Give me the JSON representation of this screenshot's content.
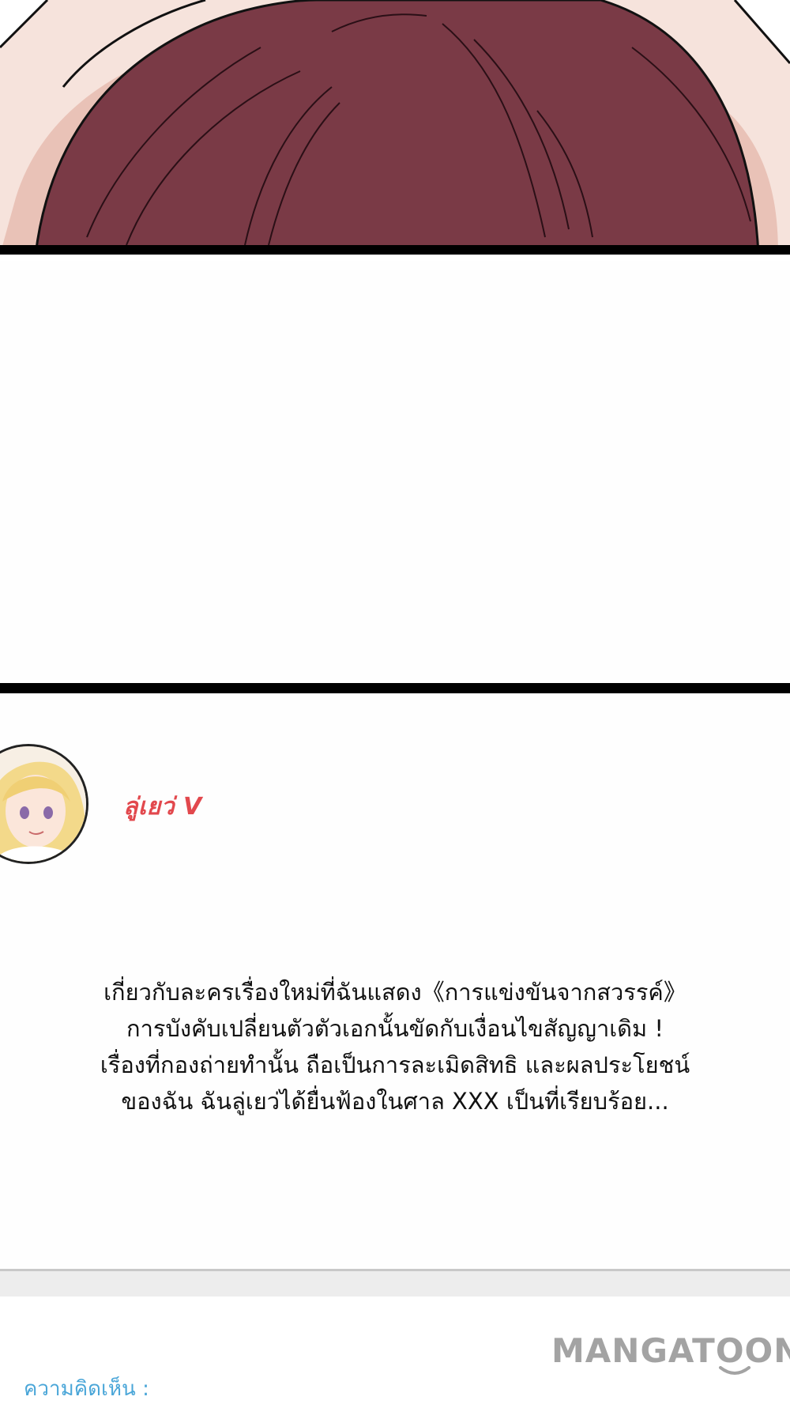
{
  "post": {
    "author_name": "ลู่เยว่ V",
    "body_lines": [
      "เกี่ยวกับละครเรื่องใหม่ที่ฉันแสดง《การแข่งขันจากสวรรค์》",
      "การบังคับเปลี่ยนตัวตัวเอกนั้นขัดกับเงื่อนไขสัญญาเดิม !",
      "เรื่องที่กองถ่ายทำนั้น ถือเป็นการละเมิดสิทธิ และผลประโยชน์",
      "ของฉัน ฉันลู่เยว่ได้ยื่นฟ้องในศาล XXX เป็นที่เรียบร้อย..."
    ]
  },
  "footer": {
    "watermark": "MANGATOON",
    "comments_label": "ความคิดเห็น :"
  },
  "colors": {
    "hair": "#7a3a46",
    "skin": "#f4d9cf",
    "author_name": "#e2484d",
    "comments_label": "#4aa6d8",
    "watermark": "#a3a3a3"
  }
}
